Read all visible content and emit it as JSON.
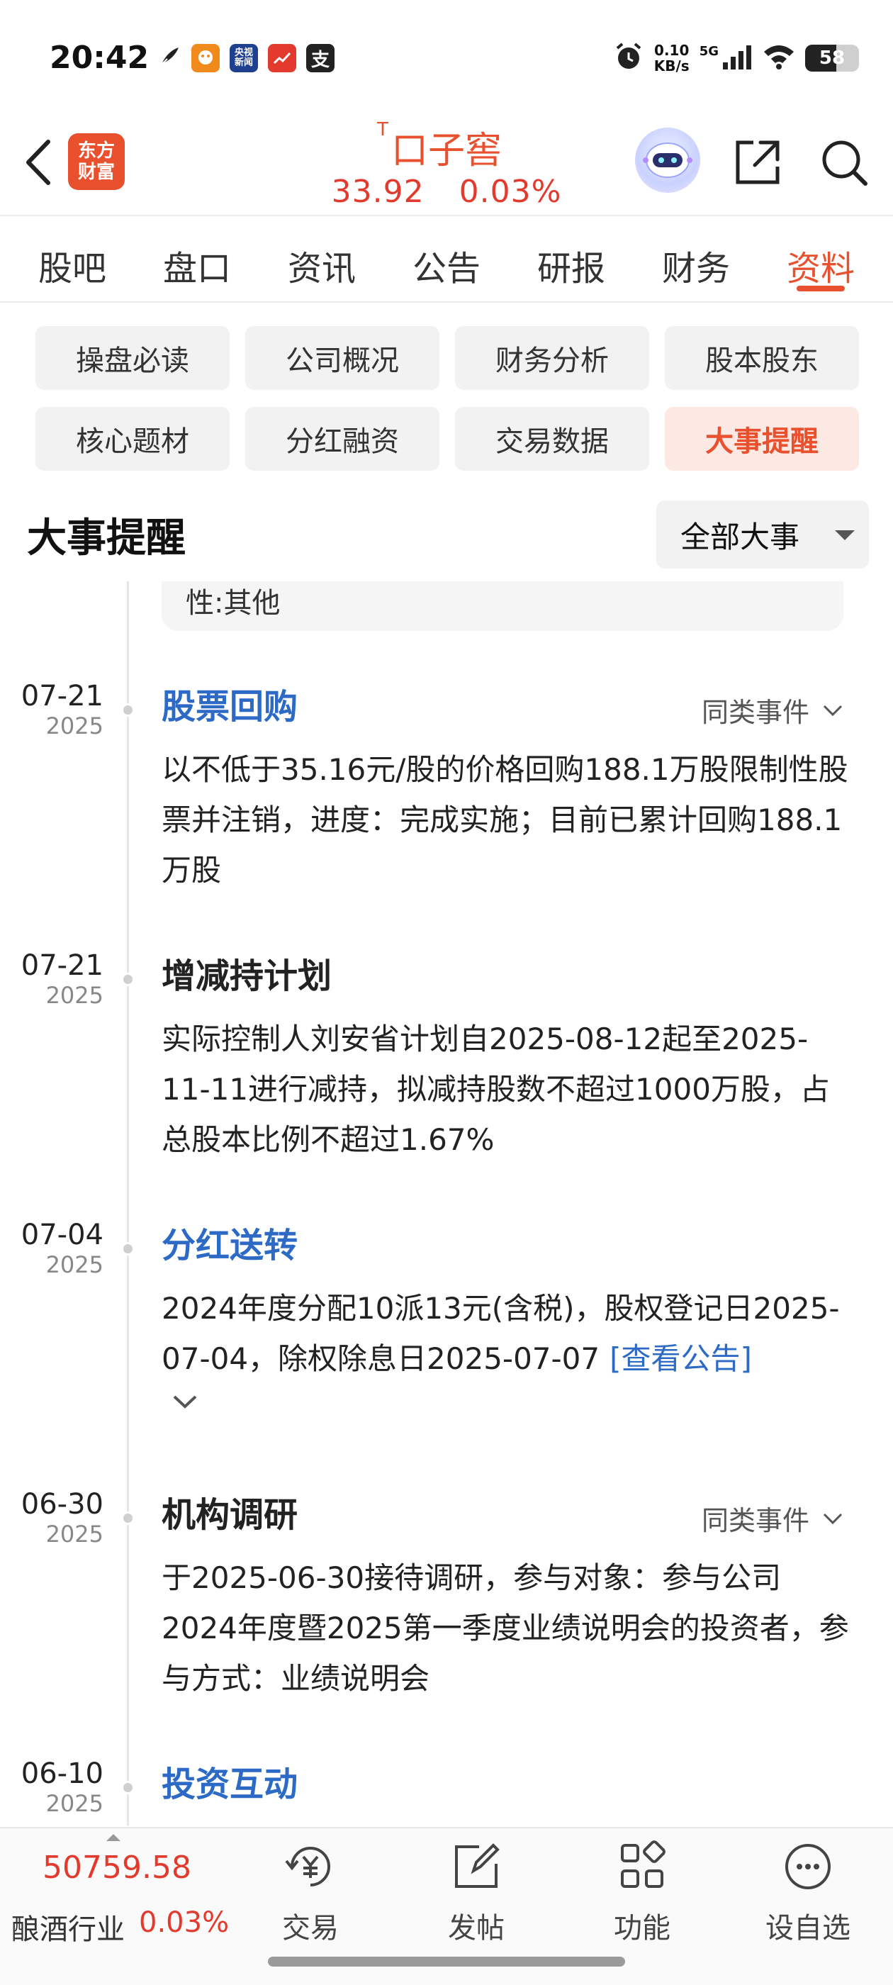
{
  "status_bar": {
    "time": "20:42",
    "net_speed_value": "0.10",
    "net_speed_unit": "KB/s",
    "network": "5G",
    "battery": "58",
    "battery_level": 0.58,
    "notification_icons": [
      "feather-icon",
      "mascot-app-icon",
      "cctv-news-icon",
      "stock-app-icon",
      "alipay-icon"
    ],
    "cctv_badge": "央视\n新闻",
    "alipay_badge": "支"
  },
  "header": {
    "logo_line1": "东方",
    "logo_line2": "财富",
    "stock_tag": "T",
    "stock_name": "口子窖",
    "price": "33.92",
    "change_pct": "0.03%"
  },
  "tabs": [
    {
      "label": "股吧",
      "active": false
    },
    {
      "label": "盘口",
      "active": false
    },
    {
      "label": "资讯",
      "active": false
    },
    {
      "label": "公告",
      "active": false
    },
    {
      "label": "研报",
      "active": false
    },
    {
      "label": "财务",
      "active": false
    },
    {
      "label": "资料",
      "active": true
    }
  ],
  "chips": [
    {
      "label": "操盘必读",
      "active": false
    },
    {
      "label": "公司概况",
      "active": false
    },
    {
      "label": "财务分析",
      "active": false
    },
    {
      "label": "股本股东",
      "active": false
    },
    {
      "label": "核心题材",
      "active": false
    },
    {
      "label": "分红融资",
      "active": false
    },
    {
      "label": "交易数据",
      "active": false
    },
    {
      "label": "大事提醒",
      "active": true
    }
  ],
  "section": {
    "title": "大事提醒",
    "filter_label": "全部大事"
  },
  "partial_card_text": "性:其他",
  "similar_label": "同类事件",
  "events": [
    {
      "md": "07-21",
      "year": "2025",
      "title": "股票回购",
      "title_style": "link",
      "show_similar": true,
      "desc": "以不低于35.16元/股的价格回购188.1万股限制性股票并注销，进度：完成实施；目前已累计回购188.1万股"
    },
    {
      "md": "07-21",
      "year": "2025",
      "title": "增减持计划",
      "title_style": "plain",
      "show_similar": false,
      "desc": "实际控制人刘安省计划自2025-08-12起至2025-11-11进行减持，拟减持股数不超过1000万股，占总股本比例不超过1.67%"
    },
    {
      "md": "07-04",
      "year": "2025",
      "title": "分红送转",
      "title_style": "link",
      "show_similar": false,
      "desc": "2024年度分配10派13元(含税)，股权登记日2025-07-04，除权除息日2025-07-07",
      "link_text": "[查看公告]"
    },
    {
      "md": "06-30",
      "year": "2025",
      "title": "机构调研",
      "title_style": "plain",
      "show_similar": true,
      "desc": "于2025-06-30接待调研，参与对象：参与公司2024年度暨2025第一季度业绩说明会的投资者，参与方式：业绩说明会"
    },
    {
      "md": "06-10",
      "year": "2025",
      "title": "投资互动",
      "title_style": "link",
      "show_similar": false,
      "desc": ""
    }
  ],
  "bottom_bar": {
    "index_value": "50759.58",
    "index_name": "酿酒行业",
    "index_pct": "0.03%",
    "items": [
      {
        "label": "交易",
        "icon": "yuan-refresh-icon"
      },
      {
        "label": "发帖",
        "icon": "edit-post-icon"
      },
      {
        "label": "功能",
        "icon": "apps-grid-icon"
      },
      {
        "label": "设自选",
        "icon": "more-dots-icon"
      }
    ]
  },
  "colors": {
    "accent": "#e8502e",
    "up": "#e23b2e",
    "link": "#2d6ac6",
    "chip_bg": "#f2f2f2",
    "chip_active_bg": "#fde9e3"
  }
}
